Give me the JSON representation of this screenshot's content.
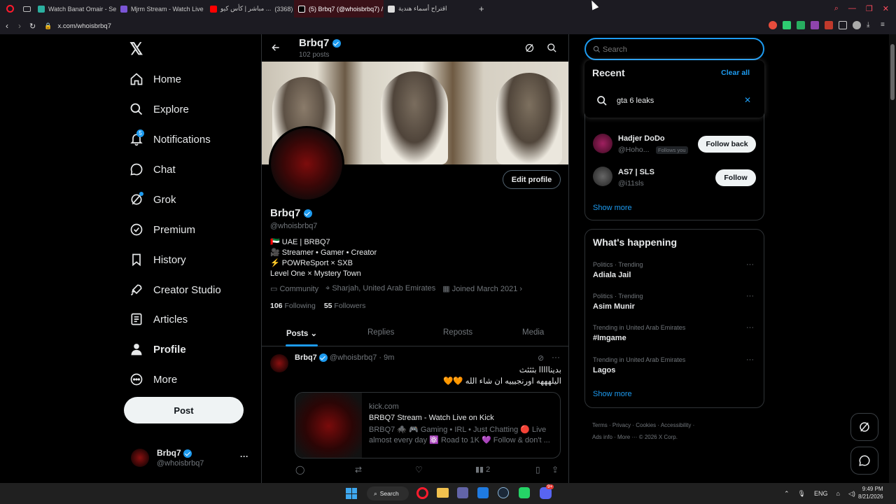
{
  "browser": {
    "tabs": [
      {
        "label": "Watch Banat Omair - Seaso",
        "color": "#2bb0a0"
      },
      {
        "label": "Mjrm Stream - Watch Live",
        "color": "#7b55d6"
      },
      {
        "label": "مباشر | كأس كيو ...",
        "color": "#ff0000"
      },
      {
        "label": "(3368)",
        "color": "#d83a3a"
      },
      {
        "label": "(5) Brbq7 (@whoisbrbq7) / ...",
        "color": "#000000"
      },
      {
        "label": "اقتراح أسماء هندية",
        "color": "#dddddd"
      }
    ],
    "new_tab": "+",
    "url": "x.com/whoisbrbq7"
  },
  "nav": {
    "logo": "𝕏",
    "items": [
      "Home",
      "Explore",
      "Notifications",
      "Chat",
      "Grok",
      "Premium",
      "History",
      "Creator Studio",
      "Articles",
      "Profile",
      "More"
    ],
    "notif_badge": "5",
    "post_button": "Post",
    "account": {
      "name": "Brbq7",
      "handle": "@whoisbrbq7",
      "more": "···"
    }
  },
  "header": {
    "name": "Brbq7",
    "posts": "102 posts"
  },
  "profile": {
    "edit_button": "Edit profile",
    "name": "Brbq7",
    "handle": "@whoisbrbq7",
    "bio": [
      "🇦🇪 UAE | BRBQ7",
      "🎥 Streamer • Gamer • Creator",
      "⚡ POWReSport × SXB",
      "Level One × Mystery Town"
    ],
    "community": "Community",
    "location": "Sharjah, United Arab Emirates",
    "joined": "Joined March 2021",
    "following_count": "106",
    "following_label": "Following",
    "followers_count": "55",
    "followers_label": "Followers"
  },
  "tabs": [
    "Posts",
    "Replies",
    "Reposts",
    "Media"
  ],
  "post": {
    "name": "Brbq7",
    "handle": "@whoisbrbq7 · 9m",
    "line1": "بدينااااا بثثثث",
    "line2": "اليلهههه اورنجيييه ان شاء الله 🧡🧡",
    "card_domain": "kick.com",
    "card_title": "BRBQ7 Stream - Watch Live on Kick",
    "card_desc": "BRBQ7 🕷️ 🎮 Gaming • IRL • Just Chatting 🔴 Live almost every day ⚛️ Road to 1K 💜 Follow & don't ...",
    "views": "2"
  },
  "search": {
    "placeholder": "Search",
    "recent_title": "Recent",
    "clear_all": "Clear all",
    "recent_query": "gta 6 leaks"
  },
  "who_to_follow": [
    {
      "name": "Hadjer DoDo",
      "handle": "@Hoho...",
      "badge": "Follows you",
      "button": "Follow back"
    },
    {
      "name": "AS7 | SLS",
      "handle": "@i11sls",
      "button": "Follow"
    }
  ],
  "show_more": "Show more",
  "happening": {
    "title": "What's happening",
    "trends": [
      {
        "context": "Politics · Trending",
        "topic": "Adiala Jail"
      },
      {
        "context": "Politics · Trending",
        "topic": "Asim Munir"
      },
      {
        "context": "Trending in United Arab Emirates",
        "topic": "#Imgame"
      },
      {
        "context": "Trending in United Arab Emirates",
        "topic": "Lagos"
      }
    ],
    "show_more": "Show more"
  },
  "footer": {
    "links": [
      "Terms",
      "Privacy",
      "Cookies",
      "Accessibility",
      "Ads info",
      "More ···"
    ],
    "copyright": "© 2026 X Corp."
  },
  "taskbar": {
    "search": "Search",
    "lang": "ENG",
    "time": "9:49 PM",
    "date": "8/21/2026",
    "discord_badge": "9+"
  }
}
